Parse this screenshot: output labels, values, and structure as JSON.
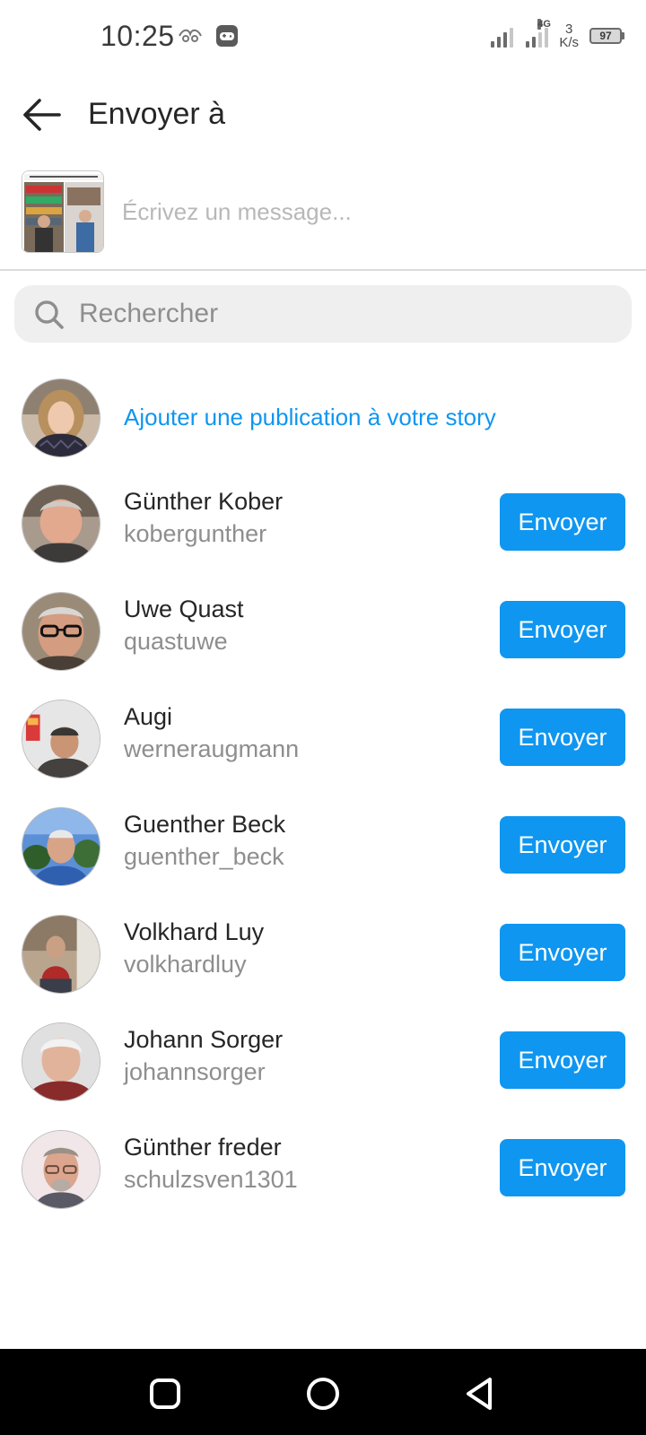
{
  "status_bar": {
    "time": "10:25",
    "network": "4G",
    "speed_value": "3",
    "speed_unit": "K/s",
    "battery": "97"
  },
  "header": {
    "title": "Envoyer à"
  },
  "composer": {
    "placeholder": "Écrivez un message..."
  },
  "search": {
    "placeholder": "Rechercher"
  },
  "story": {
    "label": "Ajouter une publication à votre story"
  },
  "contacts": [
    {
      "name": "Günther Kober",
      "username": "kobergunther",
      "action": "Envoyer"
    },
    {
      "name": "Uwe Quast",
      "username": "quastuwe",
      "action": "Envoyer"
    },
    {
      "name": "Augi",
      "username": "werneraugmann",
      "action": "Envoyer"
    },
    {
      "name": "Guenther Beck",
      "username": "guenther_beck",
      "action": "Envoyer"
    },
    {
      "name": "Volkhard Luy",
      "username": "volkhardluy",
      "action": "Envoyer"
    },
    {
      "name": "Johann Sorger",
      "username": "johannsorger",
      "action": "Envoyer"
    },
    {
      "name": "Günther freder",
      "username": "schulzsven1301",
      "action": "Envoyer"
    }
  ],
  "colors": {
    "accent": "#0f96f0",
    "text_primary": "#262626",
    "text_secondary": "#8e8e8e",
    "search_bg": "#efefef"
  },
  "nav": {
    "icons": [
      "recent-apps-icon",
      "home-icon",
      "back-icon"
    ]
  }
}
